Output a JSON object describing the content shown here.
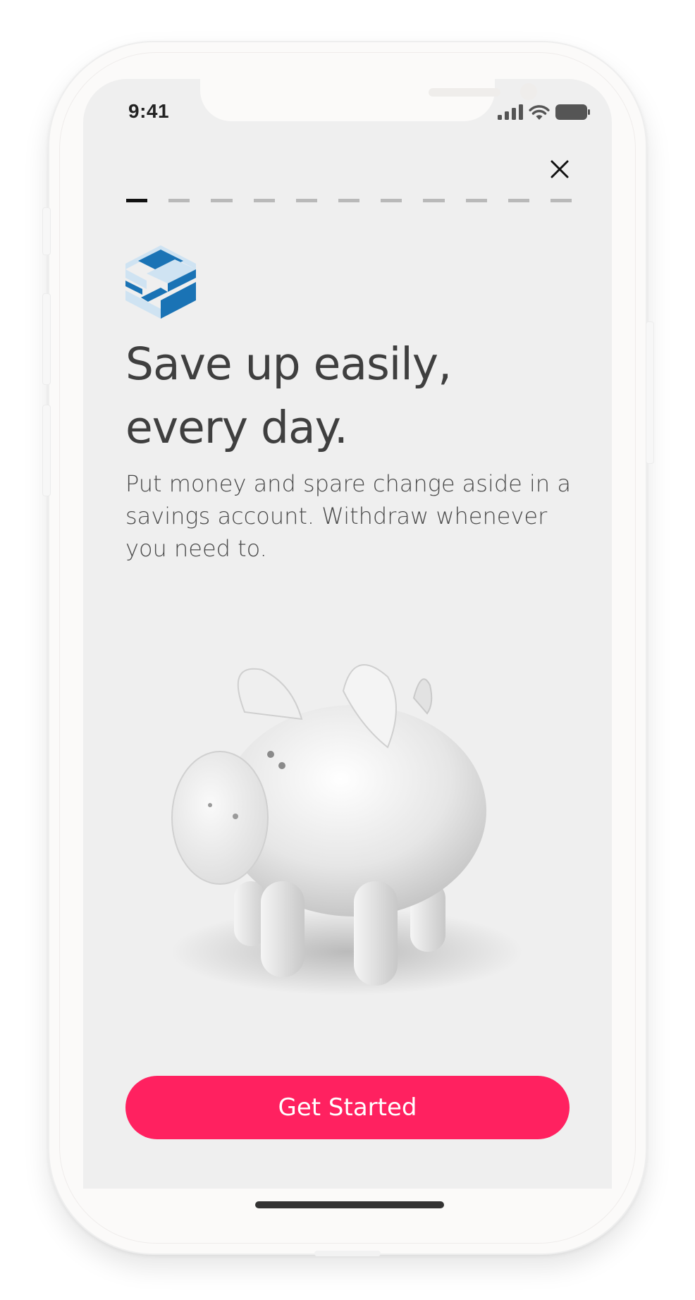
{
  "status_bar": {
    "time": "9:41",
    "icons": [
      "cellular-signal-icon",
      "wifi-icon",
      "battery-icon"
    ]
  },
  "onboarding": {
    "close_icon": "close-icon",
    "progress": {
      "total_steps": 11,
      "current_step": 1
    },
    "headline": "Save up easily, every day.",
    "description": "Put money and spare change aside in a savings account. Withdraw whenever you need to.",
    "illustration": "piggy-bank-illustration",
    "cta_label": "Get Started"
  },
  "colors": {
    "cta": "#ff2160",
    "logo_primary": "#1a73b5",
    "logo_light": "#cfe3f2",
    "screen_bg": "#efefef",
    "progress_active": "#111111",
    "progress_inactive": "#b9b9b9"
  }
}
